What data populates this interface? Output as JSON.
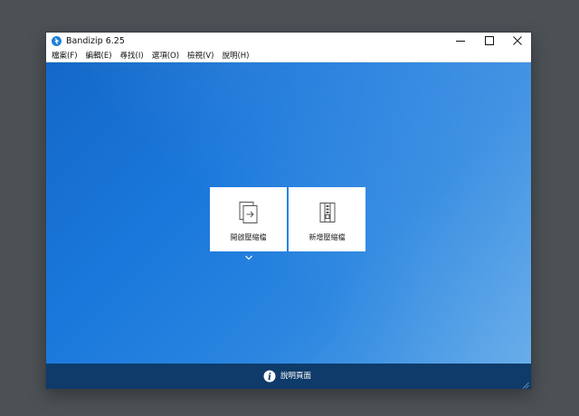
{
  "window": {
    "title": "Bandizip 6.25"
  },
  "menu": [
    {
      "label": "檔案(F)"
    },
    {
      "label": "編輯(E)"
    },
    {
      "label": "尋找(I)"
    },
    {
      "label": "選項(O)"
    },
    {
      "label": "檢視(V)"
    },
    {
      "label": "說明(H)"
    }
  ],
  "actions": {
    "open_label": "開啟壓縮檔",
    "new_label": "新增壓縮檔"
  },
  "footer": {
    "help_label": "說明頁面"
  },
  "colors": {
    "accent": "#1a78dc",
    "footer": "#0e3b6a",
    "icon": "#1f80d8"
  },
  "icons": {
    "app": "bandizip-logo-icon",
    "open": "open-archive-icon",
    "new": "new-archive-icon",
    "more": "chevron-down-icon",
    "help": "info-icon"
  }
}
